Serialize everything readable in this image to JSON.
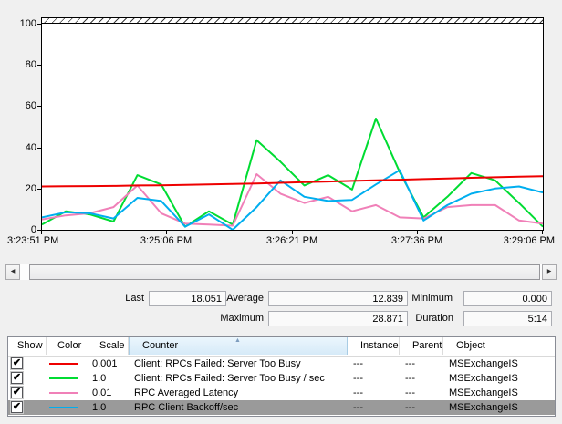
{
  "chart": {
    "y_axis_labels": [
      "100",
      "80",
      "60",
      "40",
      "20",
      "0"
    ],
    "x_axis_labels": [
      "3:23:51 PM",
      "3:25:06 PM",
      "3:26:21 PM",
      "3:27:36 PM",
      "3:29:06 PM"
    ]
  },
  "chart_data": {
    "type": "line",
    "title": "",
    "xlabel": "",
    "ylabel": "",
    "ylim": [
      0,
      100
    ],
    "grid": false,
    "x_labels": [
      "3:23:51 PM",
      "3:25:06 PM",
      "3:26:21 PM",
      "3:27:36 PM",
      "3:29:06 PM"
    ],
    "x_start": "3:23:51 PM",
    "x_end": "3:29:06 PM",
    "sample_interval_sec": 15,
    "legend_position": "table-below",
    "series": [
      {
        "name": "Client: RPCs Failed: Server Too Busy",
        "scale": "0.001",
        "color": "#EE0000",
        "values": [
          21.0,
          21.1,
          21.2,
          21.3,
          21.5,
          21.6,
          21.8,
          22.0,
          22.2,
          22.5,
          22.8,
          23.1,
          23.4,
          23.7,
          24.0,
          24.3,
          24.6,
          24.9,
          25.2,
          25.5,
          25.8,
          26.0
        ]
      },
      {
        "name": "Client: RPCs Failed: Server Too Busy / sec",
        "scale": "1.0",
        "color": "#00DC32",
        "values": [
          2.5,
          9,
          7.5,
          4,
          26.5,
          22,
          1.5,
          9,
          2.5,
          43.5,
          33,
          21.5,
          26.5,
          19.5,
          54,
          28,
          6,
          16,
          27.5,
          24,
          13,
          1.5
        ]
      },
      {
        "name": "RPC Averaged Latency",
        "scale": "0.01",
        "color": "#F080B8",
        "values": [
          5,
          7,
          8,
          11,
          21.5,
          8,
          3,
          2.5,
          2,
          27,
          17.5,
          13,
          16,
          9,
          12,
          6,
          5.5,
          11,
          12,
          12,
          4.5,
          3
        ]
      },
      {
        "name": "RPC Client Backoff/sec",
        "scale": "1.0",
        "color": "#00AEEF",
        "values": [
          6,
          8.5,
          8,
          5.5,
          15.5,
          14,
          1.5,
          7.5,
          0,
          11,
          24,
          16,
          14,
          14.5,
          22,
          28.9,
          4.5,
          12,
          17.5,
          20,
          21,
          18.1
        ]
      }
    ]
  },
  "stats": {
    "last_label": "Last",
    "last_value": "18.051",
    "average_label": "Average",
    "average_value": "12.839",
    "minimum_label": "Minimum",
    "minimum_value": "0.000",
    "maximum_label": "Maximum",
    "maximum_value": "28.871",
    "duration_label": "Duration",
    "duration_value": "5:14"
  },
  "table": {
    "columns": [
      "Show",
      "Color",
      "Scale",
      "Counter",
      "Instance",
      "Parent",
      "Object"
    ],
    "sorted_column": "Counter",
    "rows": [
      {
        "show": true,
        "color": "#EE0000",
        "scale": "0.001",
        "counter": "Client: RPCs Failed: Server Too Busy",
        "instance": "---",
        "parent": "---",
        "object": "MSExchangeIS",
        "selected": false
      },
      {
        "show": true,
        "color": "#00DC32",
        "scale": "1.0",
        "counter": "Client: RPCs Failed: Server Too Busy / sec",
        "instance": "---",
        "parent": "---",
        "object": "MSExchangeIS",
        "selected": false
      },
      {
        "show": true,
        "color": "#F080B8",
        "scale": "0.01",
        "counter": "RPC Averaged Latency",
        "instance": "---",
        "parent": "---",
        "object": "MSExchangeIS",
        "selected": false
      },
      {
        "show": true,
        "color": "#00AEEF",
        "scale": "1.0",
        "counter": "RPC Client Backoff/sec",
        "instance": "---",
        "parent": "---",
        "object": "MSExchangeIS",
        "selected": true
      }
    ]
  },
  "icons": {
    "scroll_left": "◀",
    "scroll_right": "▶",
    "sort_ascending": "▲",
    "checkmark": "✔"
  }
}
